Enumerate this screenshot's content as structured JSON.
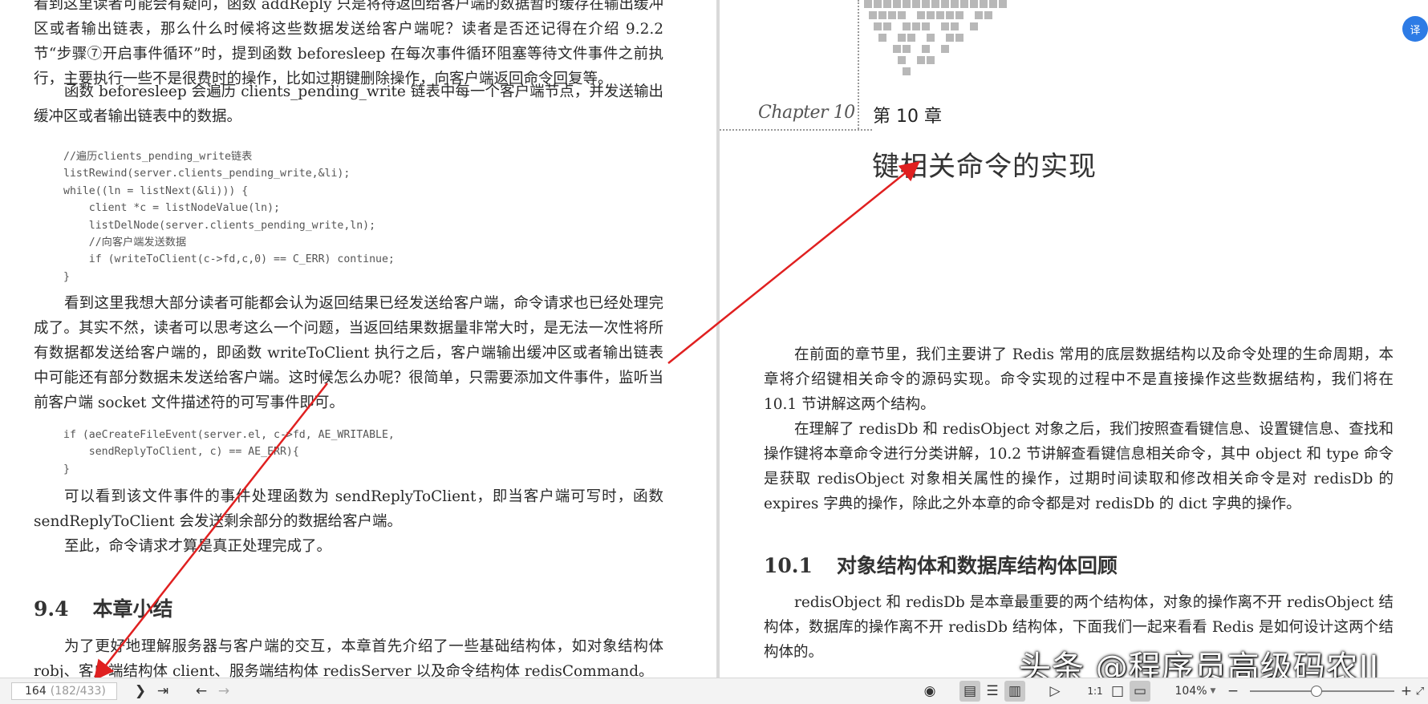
{
  "left_page": {
    "para1": "看到这里读者可能会有疑问，函数 addReply 只是将待返回给客户端的数据暂时缓存在输出缓冲区或者输出链表，那么什么时候将这些数据发送给客户端呢？读者是否还记得在介绍 9.2.2 节“步骤⑦开启事件循环”时，提到函数 beforesleep 在每次事件循环阻塞等待文件事件之前执行，主要执行一些不是很费时的操作，比如过期键删除操作，向客户端返回命令回复等。",
    "para2": "函数 beforesleep 会遍历 clients_pending_write 链表中每一个客户端节点，并发送输出缓冲区或者输出链表中的数据。",
    "code1": "//遍历clients_pending_write链表\nlistRewind(server.clients_pending_write,&li);\nwhile((ln = listNext(&li))) {\n    client *c = listNodeValue(ln);\n    listDelNode(server.clients_pending_write,ln);\n    //向客户端发送数据\n    if (writeToClient(c->fd,c,0) == C_ERR) continue;\n}",
    "para3": "看到这里我想大部分读者可能都会认为返回结果已经发送给客户端，命令请求也已经处理完成了。其实不然，读者可以思考这么一个问题，当返回结果数据量非常大时，是无法一次性将所有数据都发送给客户端的，即函数 writeToClient 执行之后，客户端输出缓冲区或者输出链表中可能还有部分数据未发送给客户端。这时候怎么办呢？很简单，只需要添加文件事件，监听当前客户端 socket 文件描述符的可写事件即可。",
    "code2": "if (aeCreateFileEvent(server.el, c->fd, AE_WRITABLE,\n    sendReplyToClient, c) == AE_ERR){\n}",
    "para4": "可以看到该文件事件的事件处理函数为 sendReplyToClient，即当客户端可写时，函数 sendReplyToClient 会发送剩余部分的数据给客户端。",
    "para5": "至此，命令请求才算是真正处理完成了。",
    "section_num": "9.4",
    "section_title": "本章小结",
    "para6": "为了更好地理解服务器与客户端的交互，本章首先介绍了一些基础结构体，如对象结构体 robj、客户端结构体 client、服务端结构体 redisServer 以及命令结构体 redisCommand。"
  },
  "right_page": {
    "chapter_script": "Chapter 10",
    "chapter_num": "第 10 章",
    "chapter_title": "键相关命令的实现",
    "para1": "在前面的章节里，我们主要讲了 Redis 常用的底层数据结构以及命令处理的生命周期，本章将介绍键相关命令的源码实现。命令实现的过程中不是直接操作这些数据结构，我们将在 10.1 节讲解这两个结构。",
    "para2": "在理解了 redisDb 和 redisObject 对象之后，我们按照查看键信息、设置键信息、查找和操作键将本章命令进行分类讲解，10.2 节讲解查看键信息相关命令，其中 object 和 type 命令是获取 redisObject 对象相关属性的操作，过期时间读取和修改相关命令是对 redisDb 的 expires 字典的操作，除此之外本章的命令都是对 redisDb 的 dict 字典的操作。",
    "section_num": "10.1",
    "section_title": "对象结构体和数据库结构体回顾",
    "para3": "redisObject 和 redisDb 是本章最重要的两个结构体，对象的操作离不开 redisObject 结构体，数据库的操作离不开 redisDb 结构体，下面我们一起来看看 Redis 是如何设计这两个结构体的。"
  },
  "toolbar": {
    "page_current": "164",
    "page_total": "(182/433)",
    "zoom": "104%",
    "zoom_level_percent": 104
  },
  "watermark": "头条 @程序员高级码农II",
  "float_button_label": "译",
  "colors": {
    "arrow": "#e02020",
    "float_button": "#2d7be5",
    "toolbar_bg": "#f3f3f3"
  },
  "icons": {
    "next": "chevron-right-icon",
    "last": "last-page-icon",
    "prev_nav": "back-icon",
    "fwd_nav": "forward-icon",
    "eye": "eye-icon",
    "single": "single-page-icon",
    "continuous": "continuous-page-icon",
    "dual": "dual-page-icon",
    "play": "play-icon",
    "actual": "actual-size-icon",
    "fitpage": "fit-page-icon",
    "fitwidth": "fit-width-icon",
    "minus": "zoom-out-icon",
    "plus": "zoom-in-icon",
    "fullscreen": "fullscreen-icon"
  }
}
